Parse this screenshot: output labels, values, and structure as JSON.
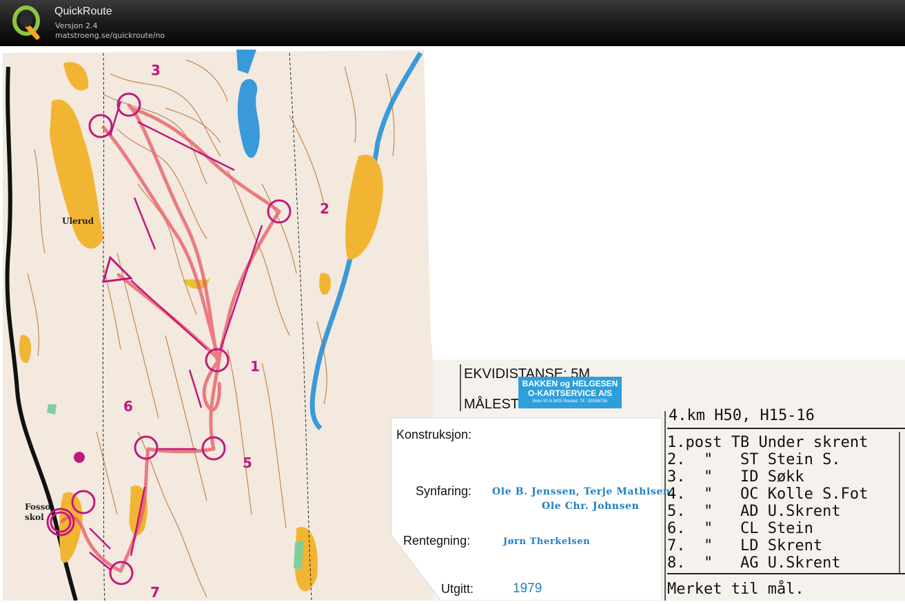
{
  "app": {
    "title": "QuickRoute",
    "version": "Versjon 2.4",
    "url": "matstroeng.se/quickroute/no"
  },
  "map": {
    "place_name_1": "Ulerud",
    "place_name_2": "Fosso",
    "place_name_3": "skol",
    "control_numbers": [
      "1",
      "2",
      "3",
      "5",
      "6",
      "7"
    ]
  },
  "legend": {
    "ekvidistanse": "EKVIDISTANSE:  5M.",
    "malestokk": "MÅLESTOKK:  1:15 000",
    "konstruksjon_label": "Konstruksjon:",
    "stamp_line1": "BAKKEN og HELGESEN",
    "stamp_line2": "O-KARTSERVICE A/S",
    "stamp_line3": "Boks 50  N 3425 Reistad.  Tlf.: 02/836736",
    "synfaring_label": "Synfaring:",
    "synfaring_line1": "Ole B. Jenssen,  Terje Mathisen,",
    "synfaring_line2": "Ole Chr. Johnsen",
    "rentegning_label": "Rentegning:",
    "rentegning_value": "Jørn Therkelsen",
    "utgitt_label": "Utgitt:",
    "utgitt_value": "1979"
  },
  "course": {
    "header": "4.km H50, H15-16",
    "rows": [
      "1.post TB Under skrent",
      "2.  \"   ST Stein S.",
      "3.  \"   ID Søkk",
      "4.  \"   OC Kolle S.Fot",
      "5.  \"   AD U.Skrent",
      "6.  \"   CL Stein",
      "7.  \"   LD Skrent",
      "8.  \"   AG U.Skrent"
    ],
    "footer": "Merket til mål."
  },
  "colors": {
    "map_paper": "#f3e9df",
    "contour": "#b5651d",
    "water": "#3a9ad9",
    "open_land": "#f2b533",
    "course_magenta": "#c0187c",
    "route_red": "#e8606a",
    "stamp_blue": "#2f9fdb"
  },
  "icons": [
    "quickroute-logo-icon"
  ]
}
